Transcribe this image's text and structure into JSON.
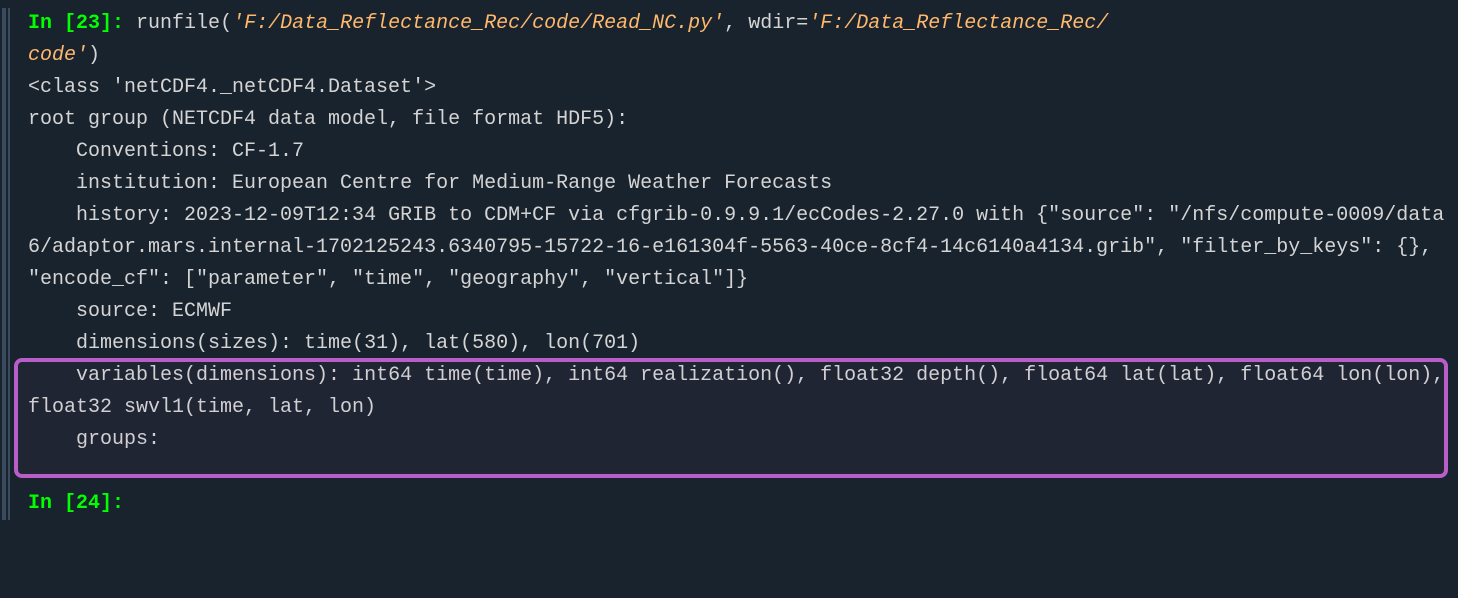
{
  "cell1": {
    "in_label": "In [",
    "num": "23",
    "close": "]: ",
    "func": "runfile",
    "arg1": "'F:/Data_Reflectance_Rec/code/Read_NC.py'",
    "sep": ", ",
    "kw": "wdir",
    "eq": "=",
    "arg2_a": "'F:/Data_Reflectance_Rec/",
    "arg2_b": "code'",
    "paren_close": ")"
  },
  "out": {
    "l1": "<class 'netCDF4._netCDF4.Dataset'>",
    "l2": "root group (NETCDF4 data model, file format HDF5):",
    "l3": "    Conventions: CF-1.7",
    "l4": "    institution: European Centre for Medium-Range Weather Forecasts",
    "l5": "    history: 2023-12-09T12:34 GRIB to CDM+CF via cfgrib-0.9.9.1/ecCodes-2.27.0 with {\"source\": \"/nfs/compute-0009/data6/adaptor.mars.internal-1702125243.6340795-15722-16-e161304f-5563-40ce-8cf4-14c6140a4134.grib\", \"filter_by_keys\": {}, \"encode_cf\": [\"parameter\", \"time\", \"geography\", \"vertical\"]}",
    "l6": "    source: ECMWF",
    "l7": "    dimensions(sizes): time(31), lat(580), lon(701)",
    "l8": "    variables(dimensions): int64 time(time), int64 realization(), float32 depth(), float64 lat(lat), float64 lon(lon), float32 swvl1(time, lat, lon)",
    "l9": "    groups: "
  },
  "cell2": {
    "in_label": "In [",
    "num": "24",
    "close": "]: "
  }
}
